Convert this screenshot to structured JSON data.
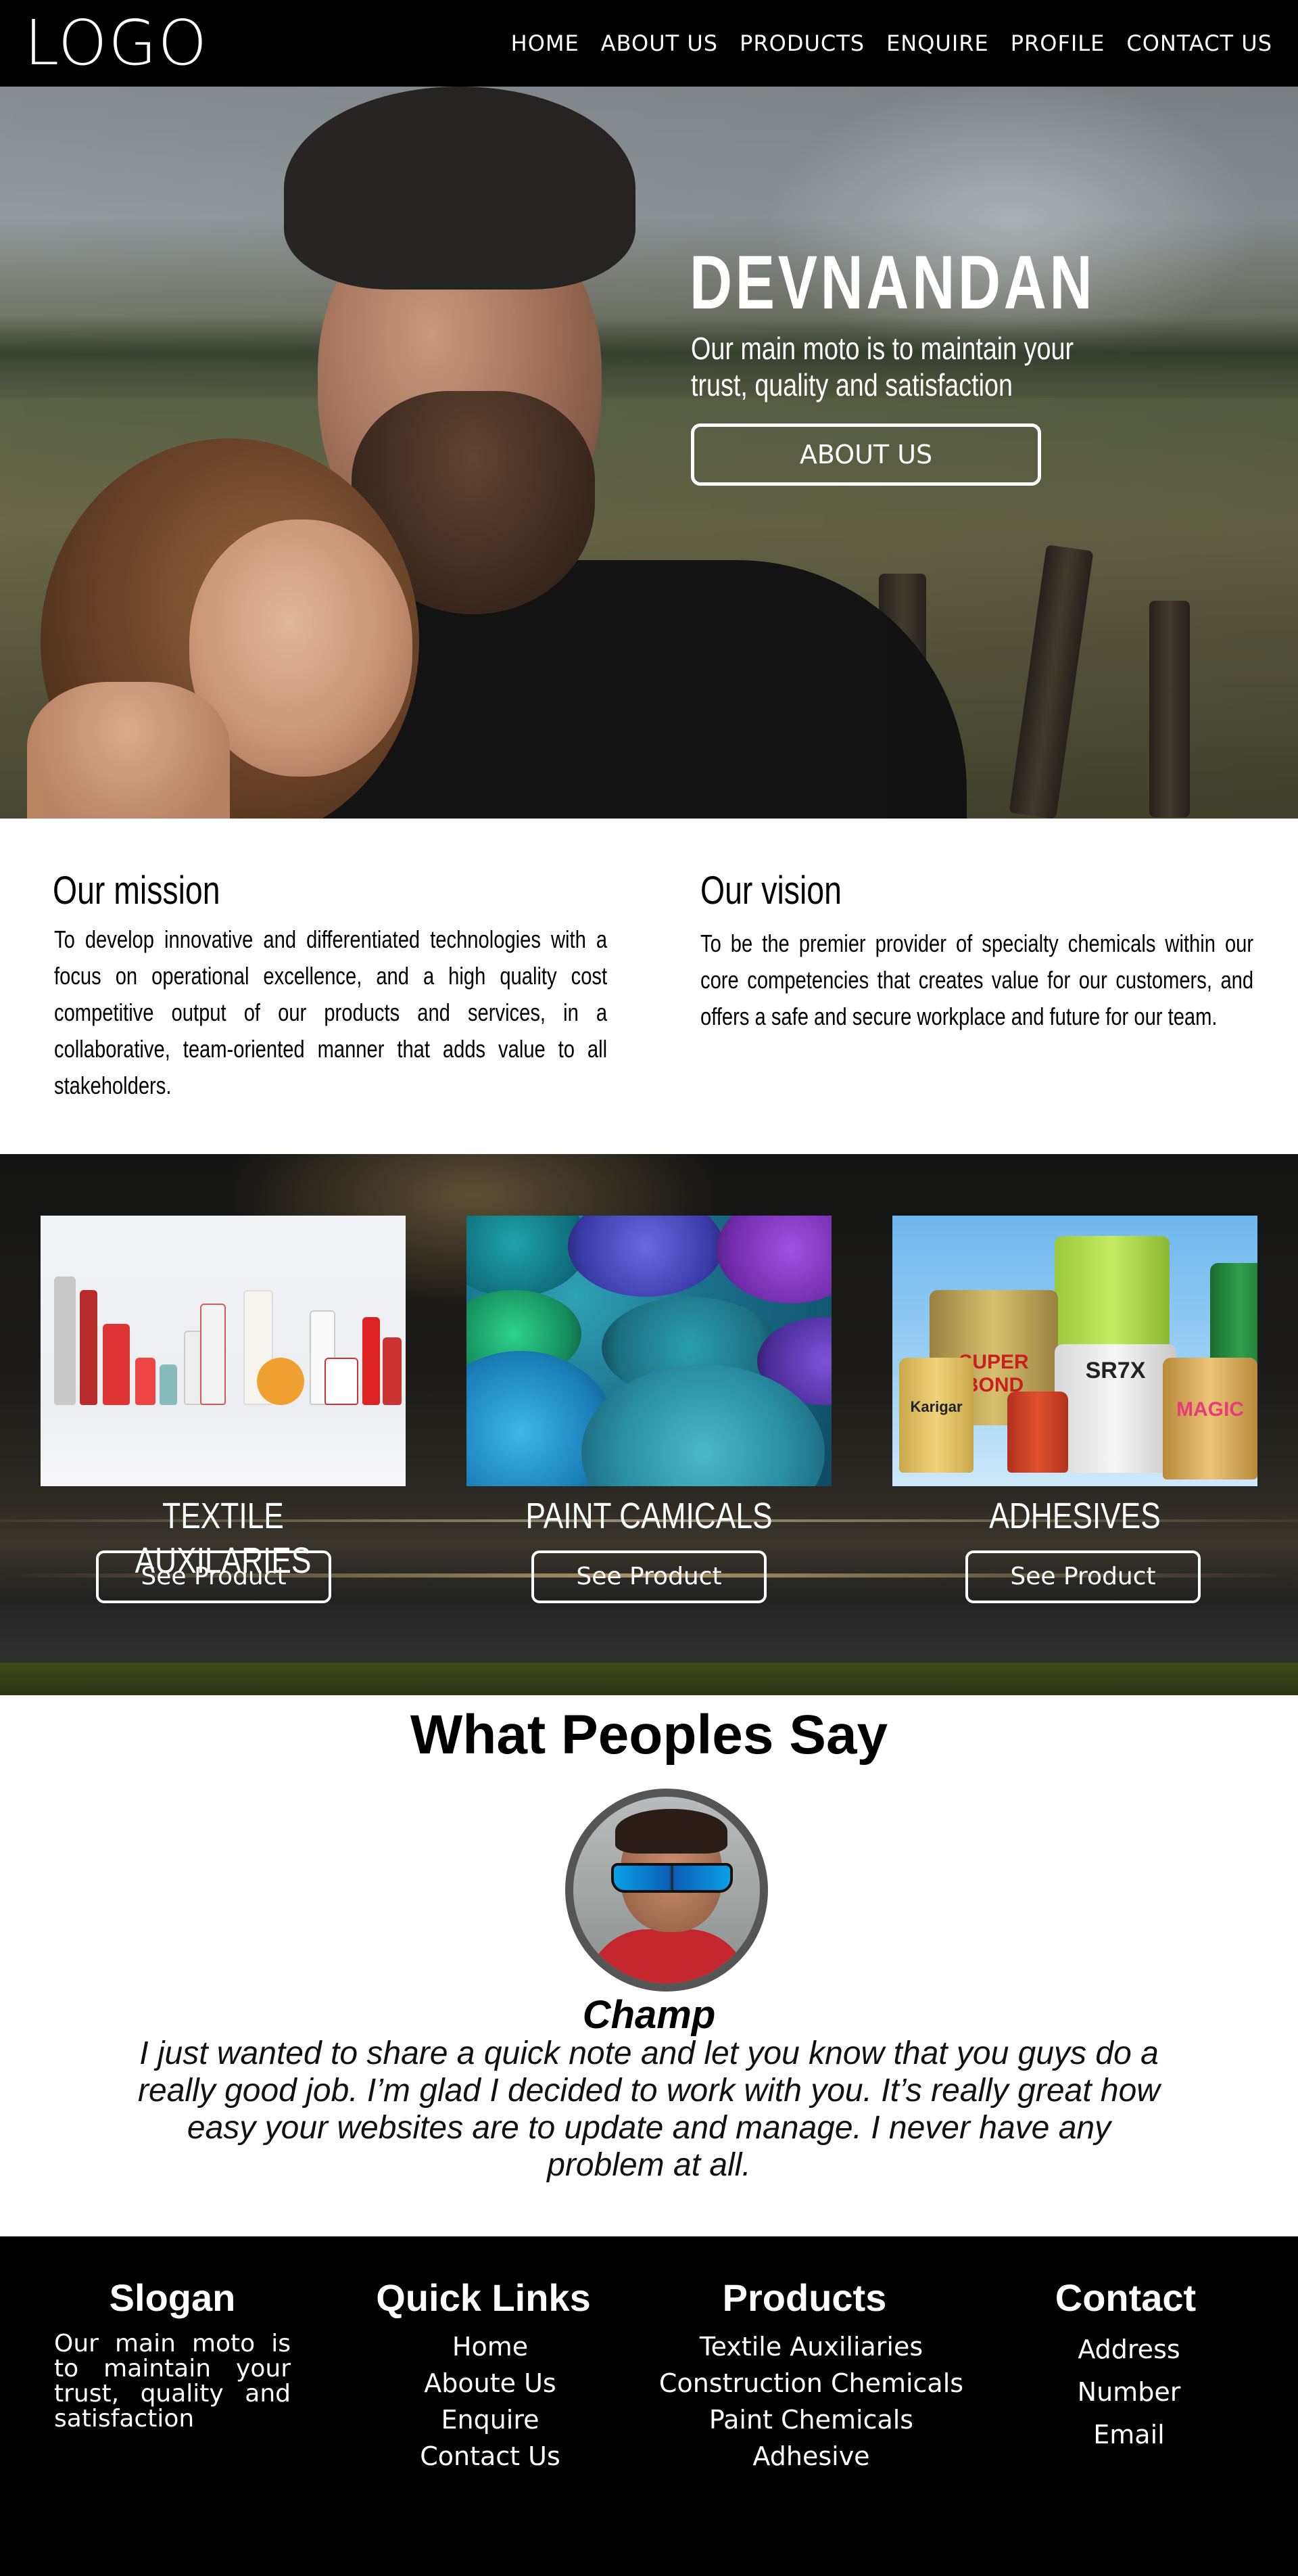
{
  "header": {
    "logo": "LOGO",
    "nav": [
      "HOME",
      "ABOUT US",
      "PRODUCTS",
      "ENQUIRE",
      "PROFILE",
      "CONTACT US"
    ]
  },
  "hero": {
    "title": "DEVNANDAN",
    "subtitle": "Our main moto is to maintain your trust, quality and satisfaction",
    "button": "ABOUT US"
  },
  "mission": {
    "title": "Our mission",
    "text": "To develop innovative and differentiated technologies with a focus on operational excellence, and a high quality cost competitive output of our products and services, in a collaborative, team-oriented manner that adds value to all stakeholders."
  },
  "vision": {
    "title": "Our vision",
    "text": "To be the premier provider of specialty chemicals within our core competencies that creates value for our customers, and offers a safe and secure workplace and future for our team."
  },
  "products": [
    {
      "title": "TEXTILE AUXILARIES",
      "button": "See Product"
    },
    {
      "title": "PAINT CAMICALS",
      "button": "See Product"
    },
    {
      "title": "ADHESIVES",
      "button": "See Product"
    }
  ],
  "testimonial": {
    "heading": "What Peoples Say",
    "name": "Champ",
    "quote": "I just wanted to share a quick note and let you know that you guys do a really good job. I’m glad I decided to work with you. It’s really great how easy your websites are to update and manage. I never have any problem at all."
  },
  "footer": {
    "slogan_title": "Slogan",
    "slogan_text": "Our main moto is to maintain your trust, quality and satisfaction",
    "links_title": "Quick Links",
    "links": [
      "Home",
      "Aboute Us",
      "Enquire",
      "Contact Us"
    ],
    "products_title": "Products",
    "products": [
      "Textile Auxiliaries",
      "Construction Chemicals",
      "Paint Chemicals",
      "Adhesive"
    ],
    "contact_title": "Contact",
    "contact": [
      "Address",
      "Number",
      "Email"
    ]
  }
}
